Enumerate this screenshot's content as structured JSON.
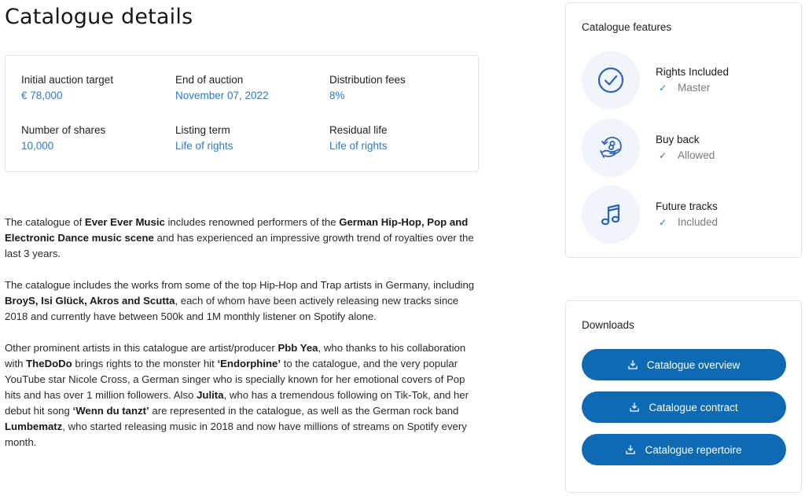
{
  "page": {
    "title": "Catalogue details"
  },
  "info": {
    "items": [
      {
        "label": "Initial auction target",
        "value": "€ 78,000"
      },
      {
        "label": "End of auction",
        "value": "November 07, 2022"
      },
      {
        "label": "Distribution fees",
        "value": "8%"
      },
      {
        "label": "Number of shares",
        "value": "10,000"
      },
      {
        "label": "Listing term",
        "value": "Life of rights"
      },
      {
        "label": "Residual life",
        "value": "Life of rights"
      }
    ]
  },
  "description": {
    "paragraphs": [
      [
        {
          "t": "The catalogue of ",
          "b": false
        },
        {
          "t": "Ever Ever Music",
          "b": true
        },
        {
          "t": " includes renowned performers of the ",
          "b": false
        },
        {
          "t": "German Hip-Hop, Pop and Electronic Dance music scene",
          "b": true
        },
        {
          "t": " and has experienced an impressive growth trend of royalties over the last 3 years.",
          "b": false
        }
      ],
      [
        {
          "t": "The catalogue includes the works from some of the top Hip-Hop and Trap artists in Germany, including ",
          "b": false
        },
        {
          "t": "BroyS, Isi Glück, Akros and Scutta",
          "b": true
        },
        {
          "t": ", each of whom have been actively releasing new tracks since 2018 and currently have between 500k and 1M monthly listener on Spotify alone.",
          "b": false
        }
      ],
      [
        {
          "t": "Other prominent artists in this catalogue are artist/producer ",
          "b": false
        },
        {
          "t": "Pbb Yea",
          "b": true
        },
        {
          "t": ", who thanks to his collaboration with ",
          "b": false
        },
        {
          "t": "TheDoDo",
          "b": true
        },
        {
          "t": " brings rights to the monster hit ",
          "b": false
        },
        {
          "t": "‘Endorphine’",
          "b": true
        },
        {
          "t": " to the catalogue, and the very popular YouTube star Nicole Cross, a German singer who is specially known for her emotional covers of Pop hits and has over 1 million followers. Also ",
          "b": false
        },
        {
          "t": "Julita",
          "b": true
        },
        {
          "t": ", who has a tremendous following on Tik-Tok, and her debut hit song ",
          "b": false
        },
        {
          "t": "‘Wenn du tanzt’",
          "b": true
        },
        {
          "t": " are represented in the catalogue, as well as the German rock band ",
          "b": false
        },
        {
          "t": "Lumbematz",
          "b": true
        },
        {
          "t": ", who started releasing music in 2018 and now have millions of streams on Spotify every month.",
          "b": false
        }
      ]
    ]
  },
  "features": {
    "title": "Catalogue features",
    "items": [
      {
        "icon": "check-circle-icon",
        "title": "Rights Included",
        "value": "Master",
        "status_icon": "checkmark-icon"
      },
      {
        "icon": "buy-back-icon",
        "title": "Buy back",
        "value": "Allowed",
        "status_icon": "checkmark-icon"
      },
      {
        "icon": "music-note-icon",
        "title": "Future tracks",
        "value": "Included",
        "status_icon": "checkmark-icon"
      }
    ]
  },
  "downloads": {
    "title": "Downloads",
    "buttons": [
      {
        "label": "Catalogue overview",
        "icon": "download-icon"
      },
      {
        "label": "Catalogue contract",
        "icon": "download-icon"
      },
      {
        "label": "Catalogue repertoire",
        "icon": "download-icon"
      }
    ]
  },
  "colors": {
    "accent": "#0f6ab4",
    "value_text": "#2a7bc4",
    "icon_circle_bg": "#eff5fa",
    "icon_stroke": "#2e63b8"
  }
}
